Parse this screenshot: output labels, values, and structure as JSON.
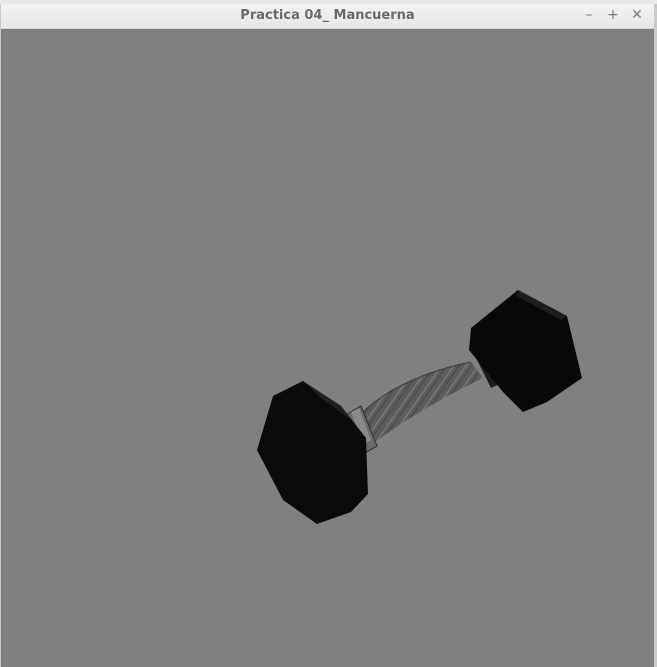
{
  "window": {
    "title": "Practica 04_ Mancuerna",
    "controls": {
      "minimize": "–",
      "maximize": "+",
      "close": "✕"
    }
  },
  "scene": {
    "background_color": "#808080",
    "object": "dumbbell"
  }
}
